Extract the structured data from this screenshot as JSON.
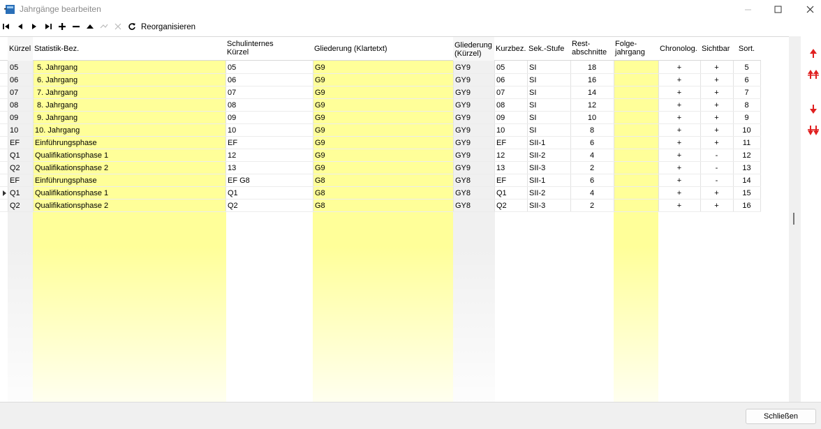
{
  "window": {
    "title": "Jahrgänge bearbeiten",
    "minimize_icon": "minimize-icon",
    "maximize_icon": "maximize-icon",
    "close_icon": "close-icon"
  },
  "toolbar": {
    "buttons": [
      "first-icon",
      "prior-icon",
      "next-icon",
      "last-icon",
      "insert-icon",
      "delete-icon",
      "edit-icon",
      "post-icon",
      "cancel-icon",
      "refresh-icon"
    ],
    "reorganize_label": "Reorganisieren"
  },
  "grid": {
    "headers": {
      "kuerzel": "Kürzel",
      "statistik": "Statistik-Bez.",
      "schulintern_1": "Schulinternes",
      "schulintern_2": "Kürzel",
      "gliederung_klartext": "Gliederung (Klartetxt)",
      "gliederung_kuerzel_1": "Gliederung",
      "gliederung_kuerzel_2": "(Kürzel)",
      "kurzbez": "Kurzbez.",
      "sekstufe": "Sek.-Stufe",
      "rest_1": "Rest-",
      "rest_2": "abschnitte",
      "folge_1": "Folge-",
      "folge_2": "jahrgang",
      "chronolog": "Chronolog.",
      "sichtbar": "Sichtbar",
      "sort": "Sort."
    },
    "rows": [
      {
        "kuerzel": "05",
        "statistik": " 5. Jahrgang",
        "schulintern": "05",
        "gliederung": "G9",
        "gliederung_k": "GY9",
        "kurzbez": "05",
        "stufe": "SI",
        "rest": "18",
        "folge": "",
        "chrono": "+",
        "sichtbar": "+",
        "sort": "5"
      },
      {
        "kuerzel": "06",
        "statistik": " 6. Jahrgang",
        "schulintern": "06",
        "gliederung": "G9",
        "gliederung_k": "GY9",
        "kurzbez": "06",
        "stufe": "SI",
        "rest": "16",
        "folge": "",
        "chrono": "+",
        "sichtbar": "+",
        "sort": "6"
      },
      {
        "kuerzel": "07",
        "statistik": " 7. Jahrgang",
        "schulintern": "07",
        "gliederung": "G9",
        "gliederung_k": "GY9",
        "kurzbez": "07",
        "stufe": "SI",
        "rest": "14",
        "folge": "",
        "chrono": "+",
        "sichtbar": "+",
        "sort": "7"
      },
      {
        "kuerzel": "08",
        "statistik": " 8. Jahrgang",
        "schulintern": "08",
        "gliederung": "G9",
        "gliederung_k": "GY9",
        "kurzbez": "08",
        "stufe": "SI",
        "rest": "12",
        "folge": "",
        "chrono": "+",
        "sichtbar": "+",
        "sort": "8"
      },
      {
        "kuerzel": "09",
        "statistik": " 9. Jahrgang",
        "schulintern": "09",
        "gliederung": "G9",
        "gliederung_k": "GY9",
        "kurzbez": "09",
        "stufe": "SI",
        "rest": "10",
        "folge": "",
        "chrono": "+",
        "sichtbar": "+",
        "sort": "9"
      },
      {
        "kuerzel": "10",
        "statistik": "10. Jahrgang",
        "schulintern": "10",
        "gliederung": "G9",
        "gliederung_k": "GY9",
        "kurzbez": "10",
        "stufe": "SI",
        "rest": "8",
        "folge": "",
        "chrono": "+",
        "sichtbar": "+",
        "sort": "10"
      },
      {
        "kuerzel": "EF",
        "statistik": "Einführungsphase",
        "schulintern": "EF",
        "gliederung": "G9",
        "gliederung_k": "GY9",
        "kurzbez": "EF",
        "stufe": "SII-1",
        "rest": "6",
        "folge": "",
        "chrono": "+",
        "sichtbar": "+",
        "sort": "11"
      },
      {
        "kuerzel": "Q1",
        "statistik": "Qualifikationsphase 1",
        "schulintern": "12",
        "gliederung": "G9",
        "gliederung_k": "GY9",
        "kurzbez": "12",
        "stufe": "SII-2",
        "rest": "4",
        "folge": "",
        "chrono": "+",
        "sichtbar": "-",
        "sort": "12"
      },
      {
        "kuerzel": "Q2",
        "statistik": "Qualifikationsphase 2",
        "schulintern": "13",
        "gliederung": "G9",
        "gliederung_k": "GY9",
        "kurzbez": "13",
        "stufe": "SII-3",
        "rest": "2",
        "folge": "",
        "chrono": "+",
        "sichtbar": "-",
        "sort": "13"
      },
      {
        "kuerzel": "EF",
        "statistik": "Einführungsphase",
        "schulintern": "EF G8",
        "gliederung": "G8",
        "gliederung_k": "GY8",
        "kurzbez": "EF",
        "stufe": "SII-1",
        "rest": "6",
        "folge": "",
        "chrono": "+",
        "sichtbar": "-",
        "sort": "14"
      },
      {
        "kuerzel": "Q1",
        "statistik": "Qualifikationsphase 1",
        "schulintern": "Q1",
        "gliederung": "G8",
        "gliederung_k": "GY8",
        "kurzbez": "Q1",
        "stufe": "SII-2",
        "rest": "4",
        "folge": "",
        "chrono": "+",
        "sichtbar": "+",
        "sort": "15",
        "current": true
      },
      {
        "kuerzel": "Q2",
        "statistik": "Qualifikationsphase 2",
        "schulintern": "Q2",
        "gliederung": "G8",
        "gliederung_k": "GY8",
        "kurzbez": "Q2",
        "stufe": "SII-3",
        "rest": "2",
        "folge": "",
        "chrono": "+",
        "sichtbar": "+",
        "sort": "16"
      }
    ]
  },
  "side_buttons": [
    "move-up-icon",
    "move-top-icon",
    "move-down-icon",
    "move-bottom-icon"
  ],
  "footer": {
    "close_label": "Schließen"
  },
  "colors": {
    "yellow_column": "#ffff99",
    "gray_column": "#f0f0f0",
    "arrow_red": "#e02020"
  }
}
